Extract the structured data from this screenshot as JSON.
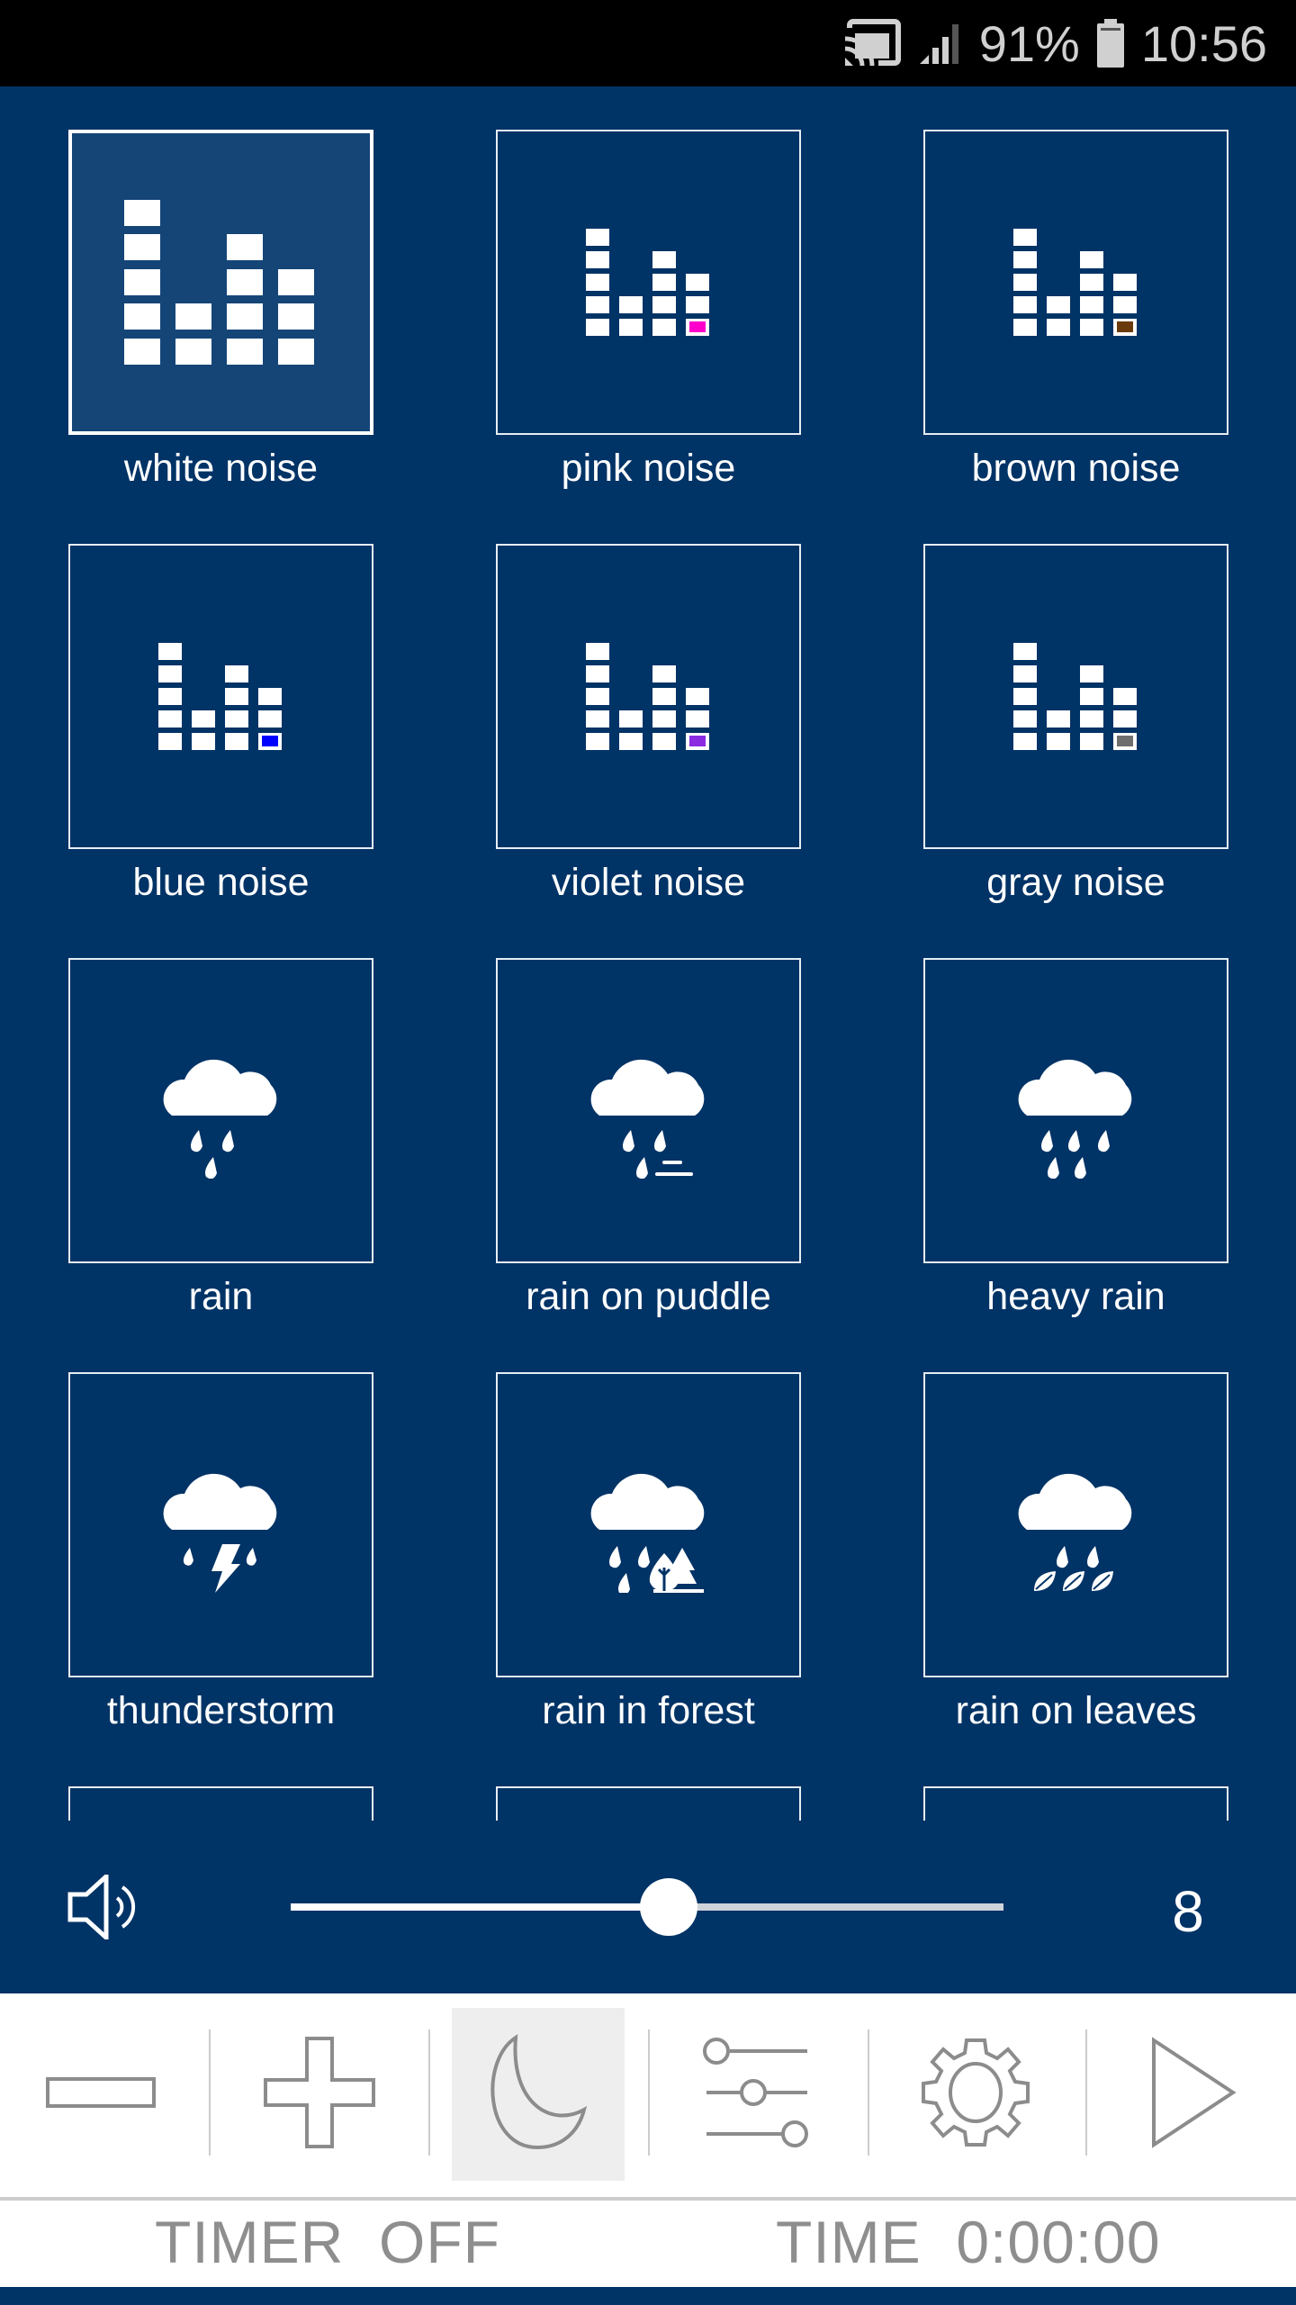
{
  "status_bar": {
    "icons": [
      "cast-icon",
      "signal-icon",
      "battery-icon"
    ],
    "battery": "91%",
    "time": "10:56"
  },
  "colors": {
    "background": "#003366",
    "selected_tile": "#154577",
    "pink": "#ff00cc",
    "brown": "#6b3a0c",
    "blue": "#0000ff",
    "violet": "#8a2be2",
    "gray": "#6e6e6e"
  },
  "sounds": [
    {
      "label": "white noise",
      "icon": "equalizer-icon",
      "selected": true
    },
    {
      "label": "pink noise",
      "icon": "equalizer-icon",
      "accent": "#ff00cc"
    },
    {
      "label": "brown noise",
      "icon": "equalizer-icon",
      "accent": "#6b3a0c"
    },
    {
      "label": "blue noise",
      "icon": "equalizer-icon",
      "accent": "#0000ff"
    },
    {
      "label": "violet noise",
      "icon": "equalizer-icon",
      "accent": "#8a2be2"
    },
    {
      "label": "gray noise",
      "icon": "equalizer-icon",
      "accent": "#6e6e6e"
    },
    {
      "label": "rain",
      "icon": "rain-icon"
    },
    {
      "label": "rain on puddle",
      "icon": "rain-puddle-icon"
    },
    {
      "label": "heavy rain",
      "icon": "heavy-rain-icon"
    },
    {
      "label": "thunderstorm",
      "icon": "thunderstorm-icon"
    },
    {
      "label": "rain in forest",
      "icon": "rain-forest-icon"
    },
    {
      "label": "rain on leaves",
      "icon": "rain-leaves-icon"
    }
  ],
  "volume": {
    "icon": "speaker-icon",
    "fraction": 0.53,
    "value": "8"
  },
  "toolbar": {
    "buttons": [
      {
        "name": "minus",
        "icon": "minus-icon"
      },
      {
        "name": "plus",
        "icon": "plus-icon"
      },
      {
        "name": "sleep-timer",
        "icon": "moon-icon",
        "active": true
      },
      {
        "name": "mixer",
        "icon": "sliders-icon"
      },
      {
        "name": "settings",
        "icon": "gear-icon"
      },
      {
        "name": "play",
        "icon": "play-icon"
      }
    ]
  },
  "footer": {
    "timer_label": "TIMER  OFF",
    "time_label": "TIME  0:00:00"
  }
}
